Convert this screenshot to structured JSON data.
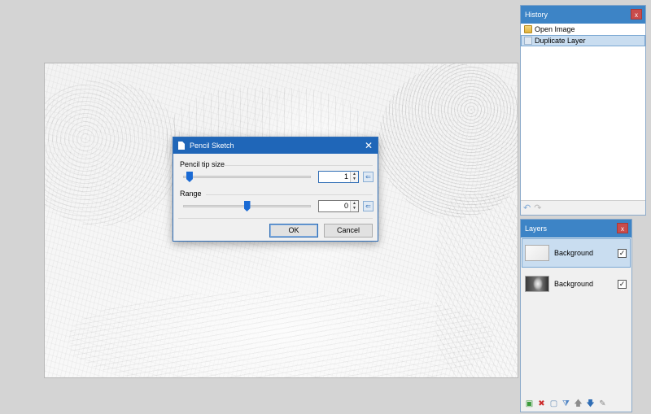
{
  "history": {
    "title": "History",
    "close": "x",
    "items": [
      {
        "label": "Open Image",
        "icon": "folder-icon"
      },
      {
        "label": "Duplicate Layer",
        "icon": "layer-icon",
        "selected": true
      }
    ],
    "undo_icon": "undo-arrow-icon",
    "redo_icon": "redo-arrow-icon"
  },
  "layers": {
    "title": "Layers",
    "close": "x",
    "items": [
      {
        "name": "Background",
        "visible": true,
        "selected": true
      },
      {
        "name": "Background",
        "visible": true,
        "selected": false
      }
    ],
    "toolbar_icons": [
      "add-layer-icon",
      "delete-layer-icon",
      "duplicate-layer-icon",
      "merge-down-icon",
      "move-up-icon",
      "move-down-icon",
      "layer-properties-icon"
    ]
  },
  "dialog": {
    "title": "Pencil Sketch",
    "close": "✕",
    "controls": [
      {
        "label": "Pencil tip size",
        "value": "1",
        "slider_fraction": 0.02
      },
      {
        "label": "Range",
        "value": "0",
        "slider_fraction": 0.5
      }
    ],
    "ok_label": "OK",
    "cancel_label": "Cancel"
  },
  "colors": {
    "panel_title": "#3d84c6",
    "dialog_title": "#1f66b8",
    "selection": "#c9ddf0",
    "close_button": "#c94c4c",
    "slider_thumb": "#1a6ad4"
  }
}
